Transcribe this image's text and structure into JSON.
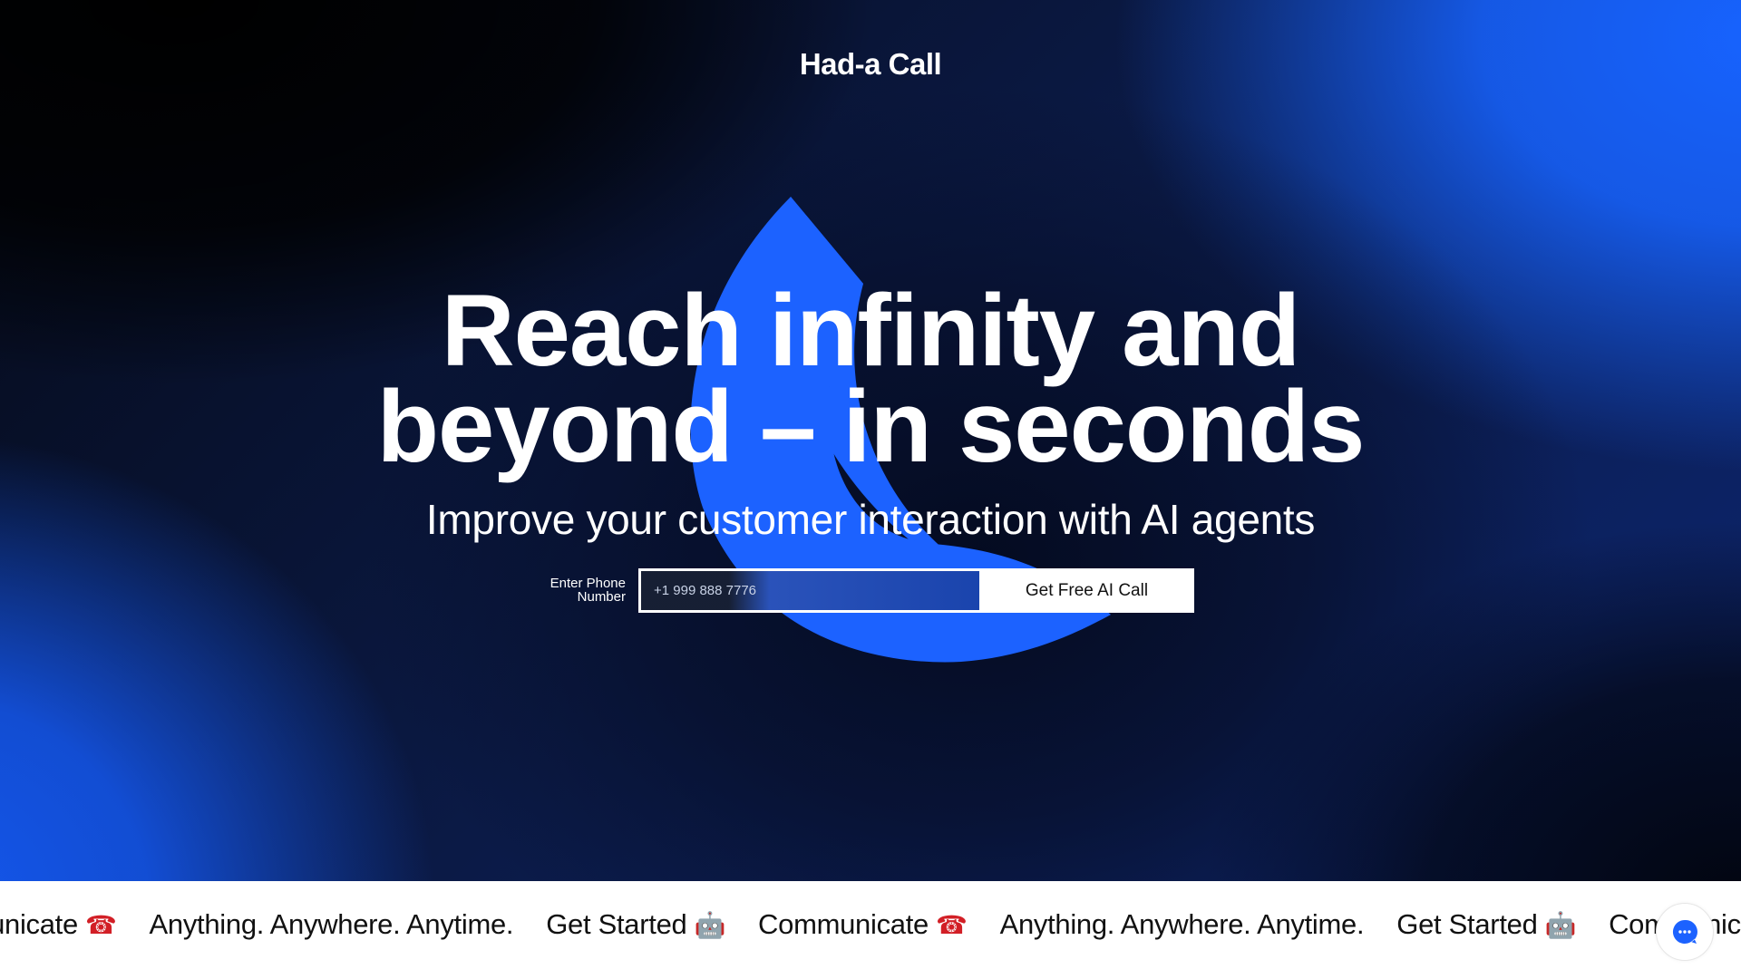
{
  "brand": {
    "name": "Had-a Call"
  },
  "hero": {
    "headline_line1": "Reach infinity and",
    "headline_line2": "beyond – in seconds",
    "subheadline": "Improve your customer interaction with AI agents"
  },
  "form": {
    "label": "Enter Phone Number",
    "phone_placeholder": "+1 999 888 7776",
    "phone_value": "",
    "submit_label": "Get Free AI Call"
  },
  "marquee": {
    "items": [
      {
        "text": "Communicate",
        "icon": "telephone-icon",
        "glyph": "☎"
      },
      {
        "text": "Anything. Anywhere. Anytime.",
        "icon": "",
        "glyph": ""
      },
      {
        "text": "Get Started",
        "icon": "robot-icon",
        "glyph": "🤖"
      }
    ]
  },
  "chat_widget": {
    "icon": "chat-bubble-icon",
    "label": ""
  },
  "colors": {
    "accent_blue": "#1c62ff",
    "background_dark": "#050a18",
    "text_light": "#ffffff",
    "marquee_bg": "#ffffff",
    "marquee_text": "#111111",
    "phone_icon_red": "#d21f26"
  }
}
